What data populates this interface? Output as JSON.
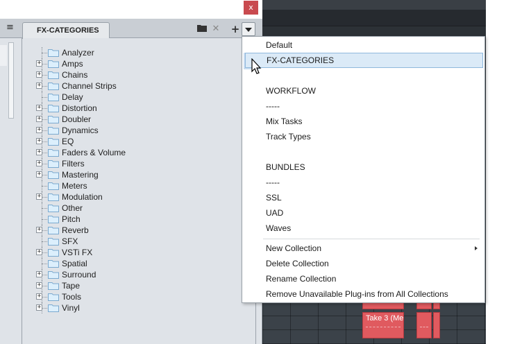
{
  "window": {
    "close_label": "x"
  },
  "toolbar": {
    "tab_label": "FX-CATEGORIES",
    "menu_icon": "hamburger-icon",
    "folder_icon": "folder-icon",
    "remove_icon": "close-icon",
    "add_icon": "plus-icon",
    "dropdown_icon": "chevron-down-icon"
  },
  "tree": {
    "items": [
      {
        "label": "Analyzer",
        "expandable": false
      },
      {
        "label": "Amps",
        "expandable": true
      },
      {
        "label": "Chains",
        "expandable": true
      },
      {
        "label": "Channel Strips",
        "expandable": true
      },
      {
        "label": "Delay",
        "expandable": false
      },
      {
        "label": "Distortion",
        "expandable": true
      },
      {
        "label": "Doubler",
        "expandable": true
      },
      {
        "label": "Dynamics",
        "expandable": true
      },
      {
        "label": "EQ",
        "expandable": true
      },
      {
        "label": "Faders & Volume",
        "expandable": true
      },
      {
        "label": "Filters",
        "expandable": true
      },
      {
        "label": "Mastering",
        "expandable": true
      },
      {
        "label": "Meters",
        "expandable": false
      },
      {
        "label": "Modulation",
        "expandable": true
      },
      {
        "label": "Other",
        "expandable": false
      },
      {
        "label": "Pitch",
        "expandable": false
      },
      {
        "label": "Reverb",
        "expandable": true
      },
      {
        "label": "SFX",
        "expandable": false
      },
      {
        "label": "VSTi FX",
        "expandable": true
      },
      {
        "label": "Spatial",
        "expandable": false
      },
      {
        "label": "Surround",
        "expandable": true
      },
      {
        "label": "Tape",
        "expandable": true
      },
      {
        "label": "Tools",
        "expandable": true
      },
      {
        "label": "Vinyl",
        "expandable": true
      }
    ]
  },
  "menu": {
    "default": "Default",
    "fx_categories": "FX-CATEGORIES",
    "workflow": "WORKFLOW",
    "workflow_sep": "-----",
    "mix_tasks": "Mix Tasks",
    "track_types": "Track Types",
    "bundles": "BUNDLES",
    "bundles_sep": "-----",
    "ssl": "SSL",
    "uad": "UAD",
    "waves": "Waves",
    "new_collection": "New Collection",
    "delete_collection": "Delete Collection",
    "rename_collection": "Rename Collection",
    "remove_unavailable": "Remove Unavailable Plug-ins from All Collections",
    "checked_icon": "checkmark-icon",
    "selected_item": "FX-CATEGORIES"
  },
  "daw": {
    "clip_take3": "Take 3 (Me",
    "clip_color": "#e05a5f"
  }
}
